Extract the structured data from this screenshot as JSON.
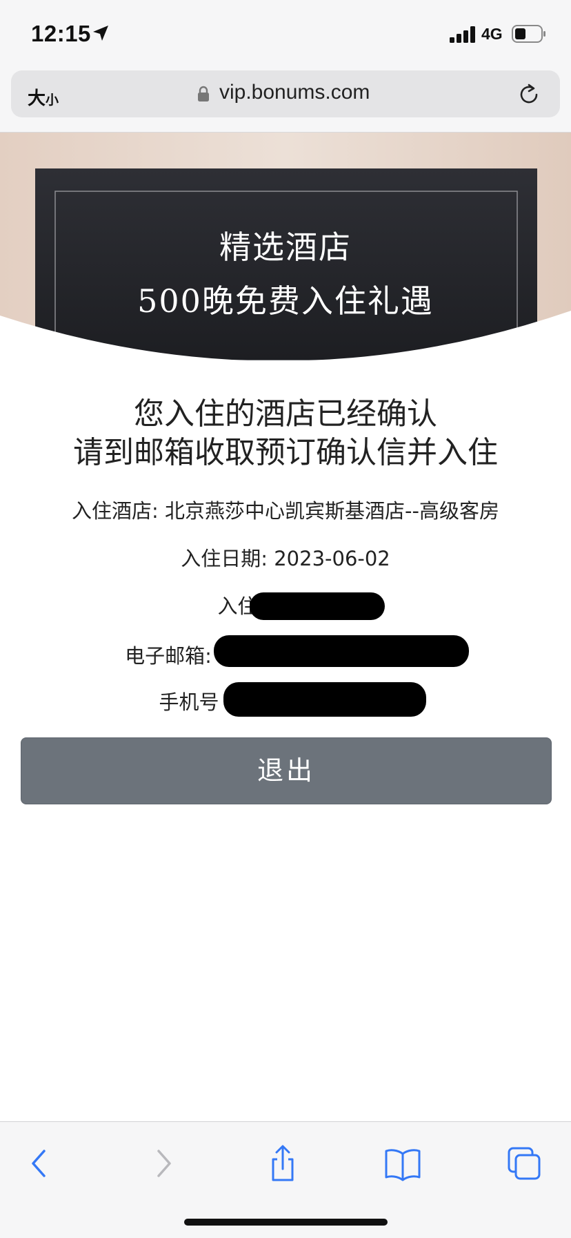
{
  "status_bar": {
    "time": "12:15",
    "network": "4G"
  },
  "address_bar": {
    "text_size_label": "大",
    "text_size_label_small": "小",
    "url": "vip.bonums.com"
  },
  "banner": {
    "line1": "精选酒店",
    "line2": "500晚免费入住礼遇"
  },
  "confirmation": {
    "headline_line1": "您入住的酒店已经确认",
    "headline_line2": "请到邮箱收取预订确认信并入住",
    "hotel_label": "入住酒店: 北京燕莎中心凯宾斯基酒店--高级客房",
    "date_label": "入住日期: 2023-06-02",
    "guest_label": "入住人",
    "email_label": "电子邮箱:",
    "phone_label": "手机号"
  },
  "exit_button": {
    "label": "退出"
  },
  "colors": {
    "banner_dark": "#25262b",
    "banner_beige": "#e6d3c6",
    "button_gray": "#6c737b",
    "ios_blue": "#3478f6"
  },
  "toolbar": {
    "icons": [
      "back-icon",
      "forward-icon",
      "share-icon",
      "bookmarks-icon",
      "tabs-icon"
    ]
  }
}
